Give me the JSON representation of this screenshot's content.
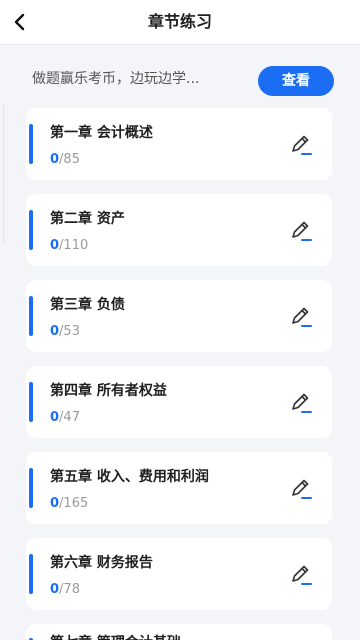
{
  "header": {
    "title": "章节练习",
    "back_icon": "chevron-left-icon"
  },
  "banner": {
    "text": "做题赢乐考币，边玩边学...",
    "button_label": "查看"
  },
  "accent_color": "#1b6ef3",
  "chapters": [
    {
      "title": "第一章 会计概述",
      "done": "0",
      "total": "/85"
    },
    {
      "title": "第二章 资产",
      "done": "0",
      "total": "/110"
    },
    {
      "title": "第三章 负债",
      "done": "0",
      "total": "/53"
    },
    {
      "title": "第四章 所有者权益",
      "done": "0",
      "total": "/47"
    },
    {
      "title": "第五章 收入、费用和利润",
      "done": "0",
      "total": "/165"
    },
    {
      "title": "第六章 财务报告",
      "done": "0",
      "total": "/78"
    },
    {
      "title": "第七章 管理会计基础",
      "done": "",
      "total": ""
    }
  ]
}
